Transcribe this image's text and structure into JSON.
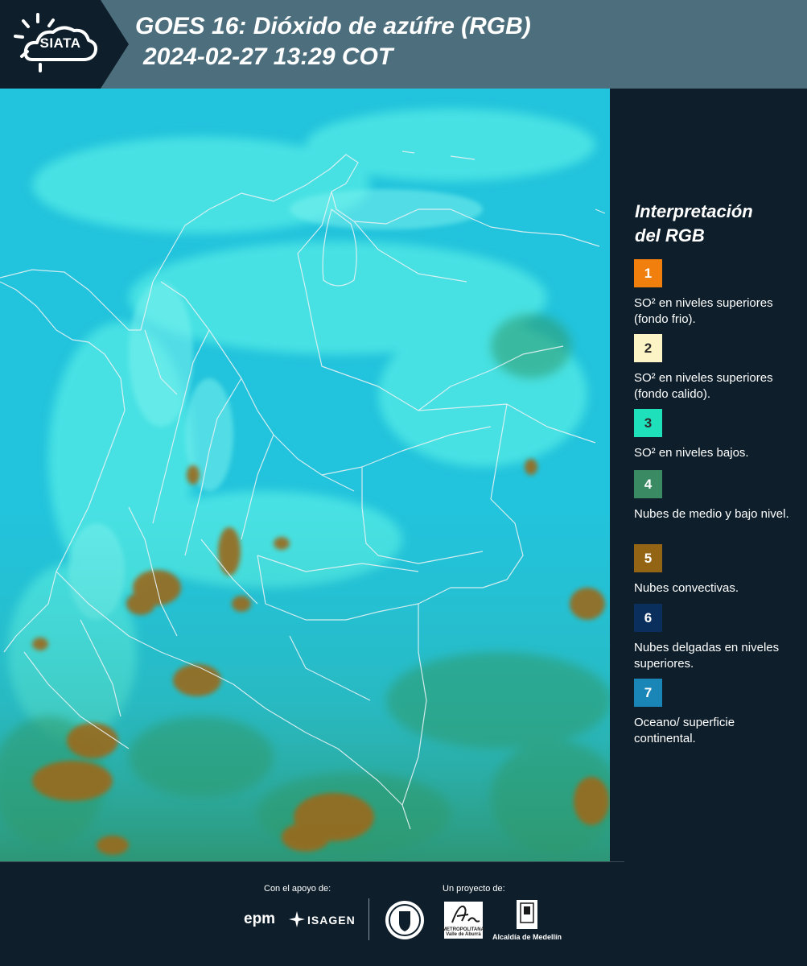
{
  "header": {
    "logo_text": "SIATA",
    "title_line1": "GOES 16: Dióxido de azúfre (RGB)",
    "title_line2": "2024-02-27 13:29 COT",
    "background_color": "#4d6f7d"
  },
  "legend": {
    "title_line1": "Interpretación",
    "title_line2": "del RGB",
    "items": [
      {
        "number": "1",
        "color": "#f07f0e",
        "label": "SO² en niveles superiores (fondo frio)."
      },
      {
        "number": "2",
        "color": "#fcf4c4",
        "label": "SO² en niveles superiores (fondo calido)."
      },
      {
        "number": "3",
        "color": "#1ee0bb",
        "label": "SO² en niveles bajos."
      },
      {
        "number": "4",
        "color": "#3a8b64",
        "label": "Nubes de medio y bajo nivel."
      },
      {
        "number": "5",
        "color": "#936414",
        "label": "Nubes convectivas."
      },
      {
        "number": "6",
        "color": "#0b2f5c",
        "label": "Nubes delgadas en niveles superiores."
      },
      {
        "number": "7",
        "color": "#1a86b8",
        "label": "Oceano/ superficie continental."
      }
    ]
  },
  "footer": {
    "support_label": "Con el apoyo de:",
    "project_label": "Un proyecto de:",
    "sponsors": [
      "epm",
      "ISAGEN"
    ],
    "partners": [
      "Área Metropolitana",
      "Alcaldía de Medellín"
    ],
    "area_caption_line1": "METROPOLITANA",
    "area_caption_line2": "Valle de Aburrá",
    "alcaldia_label": "Alcaldía de Medellín",
    "seal_icon": "medellin-seal-icon"
  },
  "map": {
    "ocean_color": "#22c3dc",
    "cloud_color": "#52e8e4",
    "low_cloud_color": "#2f9a6a",
    "convective_color": "#9a6a1a",
    "border_color": "#e6f2f4"
  }
}
